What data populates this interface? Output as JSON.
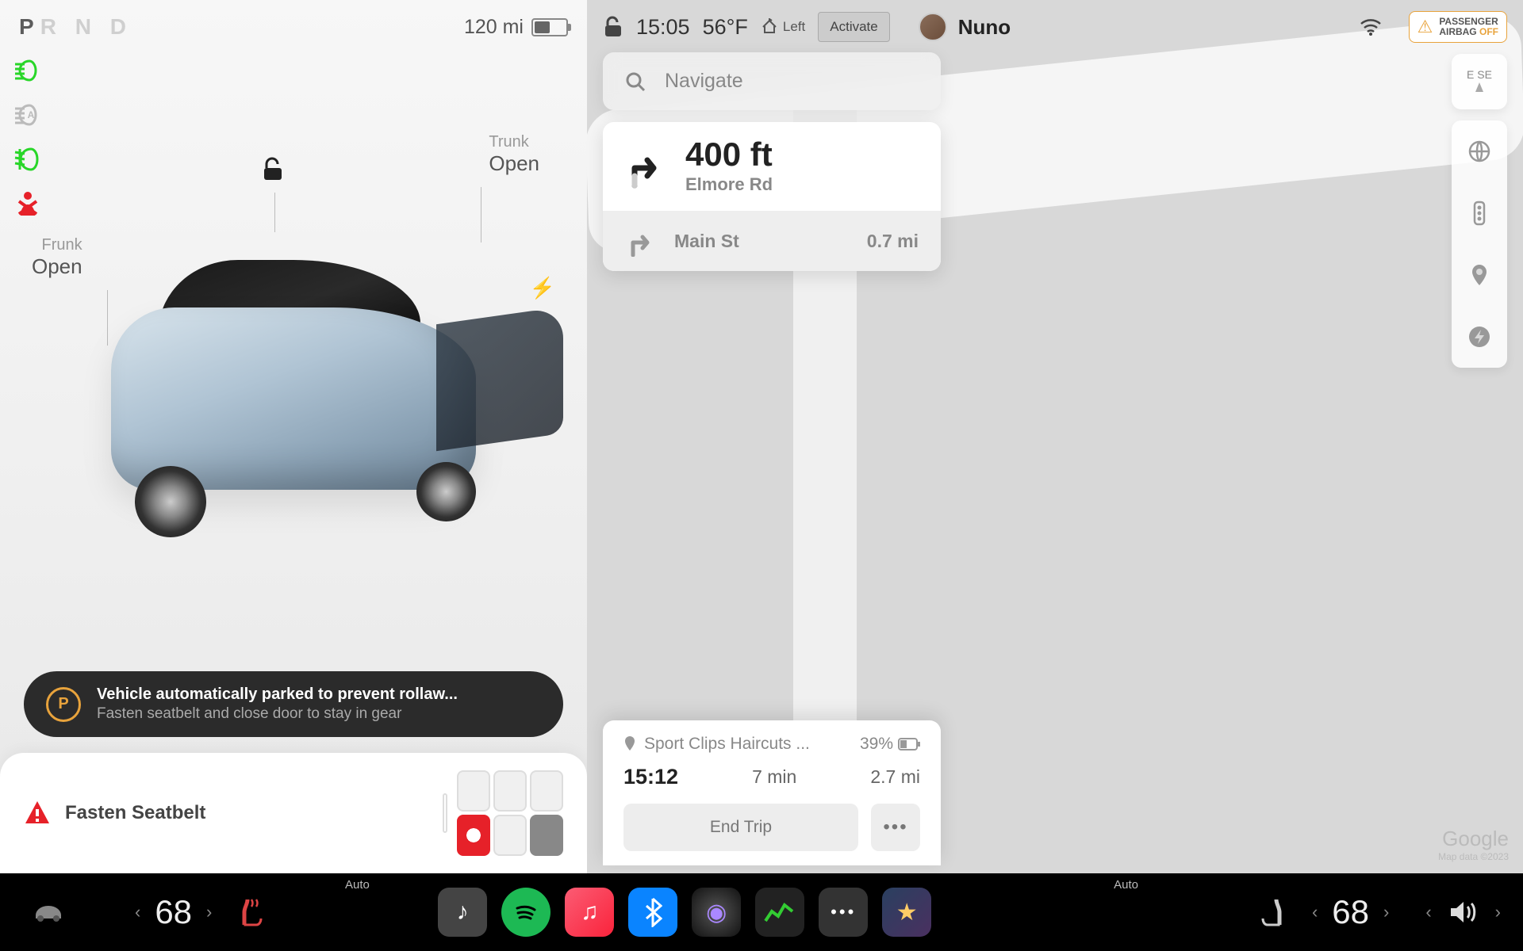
{
  "status": {
    "gear_active": "P",
    "gear_inactive": "R N D",
    "range": "120 mi"
  },
  "labels": {
    "frunk": "Frunk",
    "frunk_state": "Open",
    "trunk": "Trunk",
    "trunk_state": "Open"
  },
  "alert": {
    "main": "Vehicle automatically parked to prevent rollaw...",
    "sub": "Fasten seatbelt and close door to stay in gear"
  },
  "seatbelt": {
    "text": "Fasten Seatbelt"
  },
  "topbar": {
    "time": "15:05",
    "temp": "56°F",
    "tire_label": "Left",
    "activate": "Activate",
    "profile": "Nuno",
    "airbag_line1": "PASSENGER",
    "airbag_line2": "AIRBAG",
    "airbag_off": "OFF"
  },
  "search": {
    "placeholder": "Navigate"
  },
  "directions": {
    "primary_distance": "400 ft",
    "primary_road": "Elmore Rd",
    "secondary_road": "Main St",
    "secondary_distance": "0.7 mi"
  },
  "compass": {
    "dir1": "E",
    "dir2": "SE"
  },
  "trip": {
    "destination": "Sport Clips Haircuts ...",
    "arrival_battery": "39%",
    "eta": "15:12",
    "duration": "7 min",
    "distance": "2.7 mi",
    "end_trip": "End Trip"
  },
  "map_attr": {
    "brand": "Google",
    "copy": "Map data ©2023"
  },
  "bottombar": {
    "temp_left": "68",
    "temp_right": "68",
    "auto_left": "Auto",
    "auto_right": "Auto"
  }
}
